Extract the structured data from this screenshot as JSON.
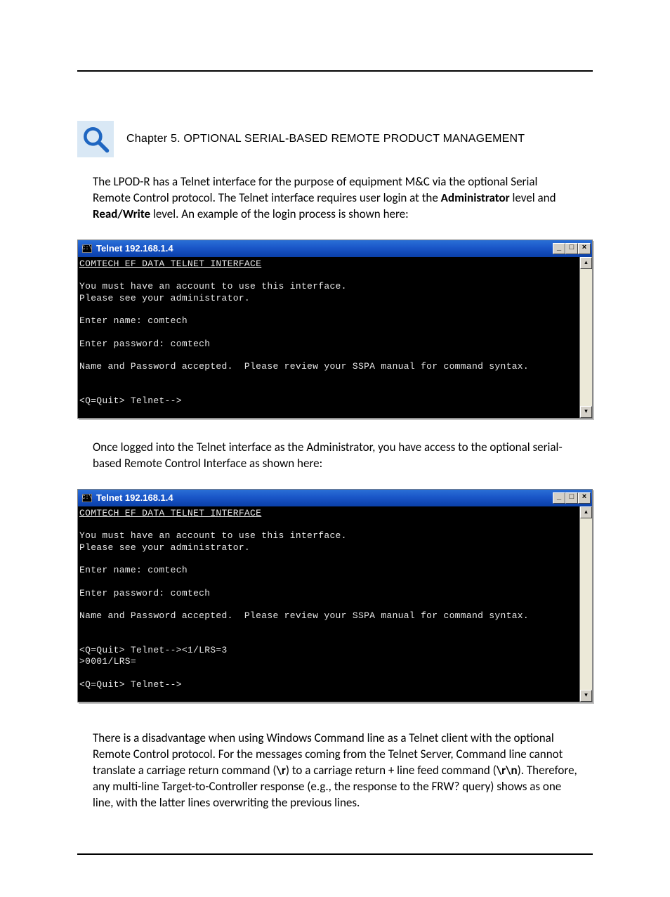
{
  "chapter": {
    "label": "Chapter 5. OPTIONAL SERIAL-BASED REMOTE PRODUCT MANAGEMENT"
  },
  "para1": {
    "pre": "The LPOD-R has a Telnet interface for the purpose of equipment M&C via the optional Serial Remote Control protocol. The Telnet interface requires user login at the ",
    "b1": "Administrator",
    "mid": " level and ",
    "b2": "Read/Write",
    "post": " level. An example of the login process is shown here:"
  },
  "telnet1": {
    "title_prefix": "C:\\",
    "title": "Telnet 192.168.1.4",
    "console": "COMTECH EF DATA TELNET INTERFACE\n\nYou must have an account to use this interface.\nPlease see your administrator.\n\nEnter name: comtech\n\nEnter password: comtech\n\nName and Password accepted.  Please review your SSPA manual for command syntax.\n\n\n<Q=Quit> Telnet-->"
  },
  "para2": "Once logged into the Telnet interface as the Administrator, you have access to the optional serial-based Remote Control Interface as shown here:",
  "telnet2": {
    "title_prefix": "C:\\",
    "title": "Telnet 192.168.1.4",
    "console": "COMTECH EF DATA TELNET INTERFACE\n\nYou must have an account to use this interface.\nPlease see your administrator.\n\nEnter name: comtech\n\nEnter password: comtech\n\nName and Password accepted.  Please review your SSPA manual for command syntax.\n\n\n<Q=Quit> Telnet--><1/LRS=3\n>0001/LRS=\n\n<Q=Quit> Telnet-->"
  },
  "para3": {
    "pre": "There is a disadvantage when using Windows Command line as a Telnet client with the optional Remote Control protocol. For the messages coming from the Telnet Server, Command line cannot translate a carriage return command (",
    "b1": "\\r",
    "mid": ") to a carriage return + line feed command (",
    "b2": "\\r\\n",
    "post": "). Therefore, any multi-line Target-to-Controller response (e.g., the response to the FRW? query) shows as one line, with the latter lines overwriting the previous lines."
  },
  "winbuttons": {
    "min": "_",
    "max": "□",
    "close": "×",
    "up": "▴",
    "down": "▾"
  }
}
